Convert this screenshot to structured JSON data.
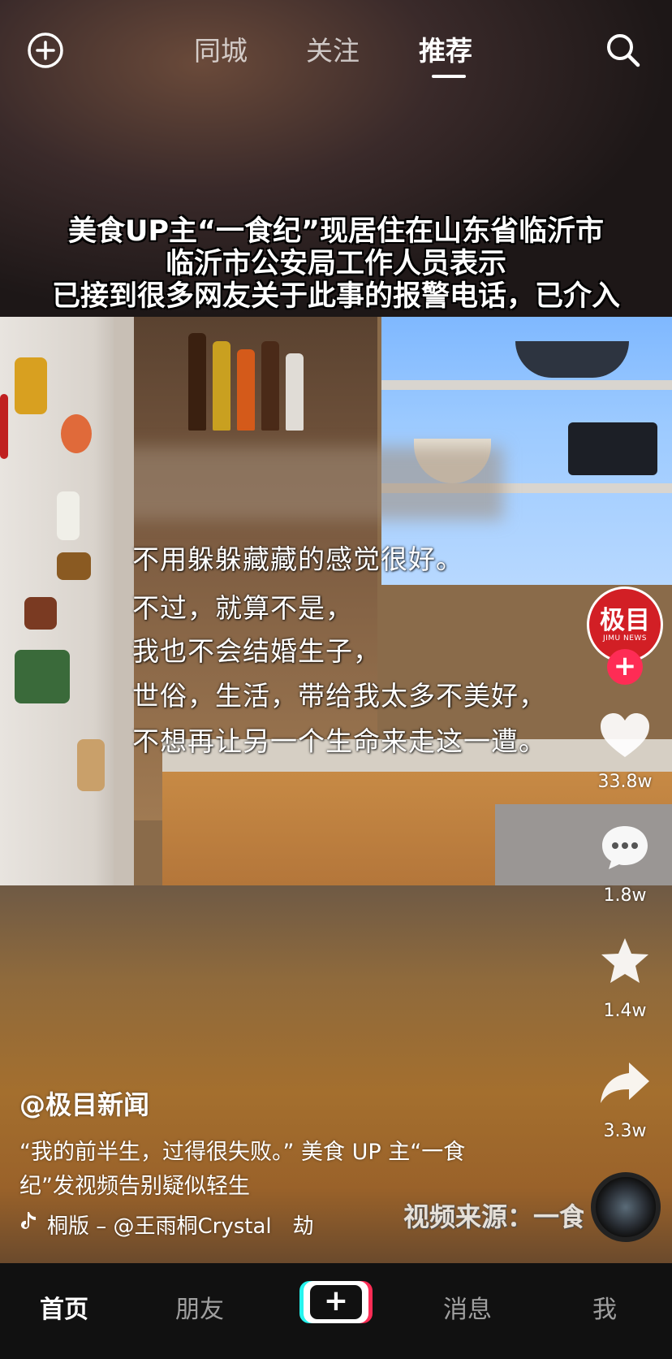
{
  "top_nav": {
    "tabs": [
      {
        "label": "同城"
      },
      {
        "label": "关注"
      },
      {
        "label": "推荐"
      }
    ],
    "active_tab": "推荐",
    "left_icon": "add-circle-icon",
    "right_icon": "search-icon"
  },
  "headline": {
    "lines": [
      "美食UP主“一食纪”现居住在山东省临沂市",
      "临沂市公安局工作人员表示",
      "已接到很多网友关于此事的报警电话，已介入"
    ]
  },
  "video_subtitles": [
    "不用躲躲藏藏的感觉很好。",
    "不过，就算不是，",
    "我也不会结婚生子，",
    "世俗，生活，带给我太多不美好，",
    "不想再让另一个生命来走这一遭。"
  ],
  "creator_avatar": {
    "main_text": "极目",
    "sub_text": "JIMU NEWS",
    "follow_symbol": "+"
  },
  "right_rail": {
    "likes": "33.8w",
    "comments": "1.8w",
    "favorites": "1.4w",
    "shares": "3.3w"
  },
  "caption": {
    "author": "@极目新闻",
    "description": "“我的前半生，过得很失败。” 美食 UP 主“一食纪”发视频告别疑似轻生",
    "music": "桐版 – @王雨桐Crystal　劫",
    "music_icon": "tiktok-note-icon"
  },
  "watermark": "视频来源：一食",
  "bottom_nav": {
    "home": "首页",
    "friends": "朋友",
    "create": "+",
    "messages": "消息",
    "me": "我",
    "active": "首页"
  },
  "colors": {
    "accent_red": "#fe2c55",
    "accent_cyan": "#25f4ee",
    "avatar_red": "#d21f25",
    "tab_bar_bg": "#111111"
  }
}
